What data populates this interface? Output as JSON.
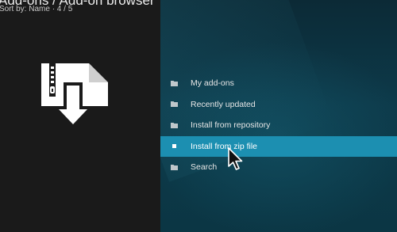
{
  "header": {
    "title": "Add-ons / Add-on browser",
    "subtitle": "Sort by: Name  ·  4 / 5"
  },
  "hero": {
    "icon": "zip-download-icon"
  },
  "menu": {
    "items": [
      {
        "label": "My add-ons",
        "icon": "folder-icon"
      },
      {
        "label": "Recently updated",
        "icon": "folder-icon"
      },
      {
        "label": "Install from repository",
        "icon": "folder-icon"
      },
      {
        "label": "Install from zip file",
        "icon": "square-icon",
        "selected": true
      },
      {
        "label": "Search",
        "icon": "folder-icon"
      }
    ]
  },
  "colors": {
    "left_bg": "#1a1a1a",
    "right_bg": "#0d3a4a",
    "selected_bg": "#1c8fb1",
    "text": "#e6e6e6"
  }
}
